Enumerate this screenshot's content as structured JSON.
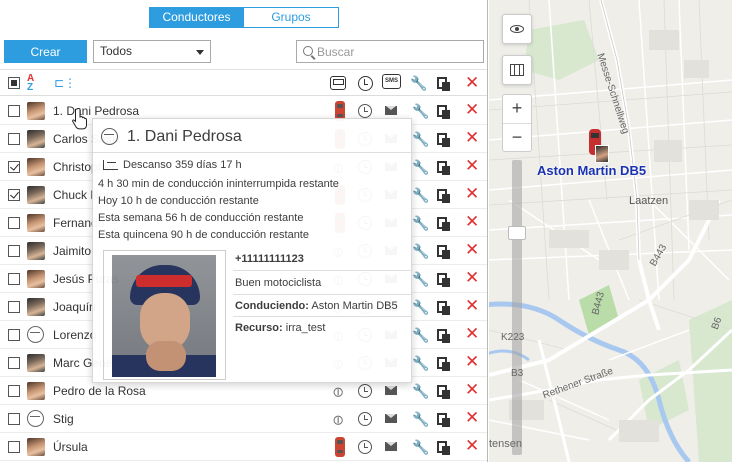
{
  "tabs": [
    {
      "label": "Conductores",
      "active": true
    },
    {
      "label": "Grupos",
      "active": false
    }
  ],
  "toolbar": {
    "create_label": "Crear",
    "filter_value": "Todos",
    "search_placeholder": "Buscar"
  },
  "header": {
    "az_top": "A",
    "az_bottom": "Z",
    "sms_label": "SMS"
  },
  "drivers": [
    {
      "name": "1. Dani Pedrosa",
      "checked": false,
      "avatar": "photo",
      "car": true
    },
    {
      "name": "Carlos Sainz",
      "checked": false,
      "avatar": "photo",
      "car": true
    },
    {
      "name": "Christopher",
      "checked": true,
      "avatar": "photo",
      "car": false
    },
    {
      "name": "Chuck Norris",
      "checked": true,
      "avatar": "photo",
      "car": true
    },
    {
      "name": "Fernando",
      "checked": false,
      "avatar": "photo",
      "car": true
    },
    {
      "name": "Jaimito",
      "checked": false,
      "avatar": "photo",
      "car": false
    },
    {
      "name": "Jesús Puras",
      "checked": false,
      "avatar": "photo",
      "car": false
    },
    {
      "name": "Joaquín",
      "checked": false,
      "avatar": "photo",
      "car": false
    },
    {
      "name": "Lorenzo",
      "checked": false,
      "avatar": "wheel",
      "car": false
    },
    {
      "name": "Marc Gené",
      "checked": false,
      "avatar": "photo",
      "car": false
    },
    {
      "name": "Pedro de la Rosa",
      "checked": false,
      "avatar": "photo",
      "car": false
    },
    {
      "name": "Stig",
      "checked": false,
      "avatar": "wheel",
      "car": false
    },
    {
      "name": "Úrsula",
      "checked": false,
      "avatar": "photo",
      "car": true
    }
  ],
  "popup": {
    "title": "1. Dani Pedrosa",
    "rest": "Descanso 359 días 17 h",
    "lines": [
      "4 h 30 min de conducción ininterrumpida restante",
      "Hoy 10 h de conducción restante",
      "Esta semana 56 h de conducción restante",
      "Esta quincena 90 h de conducción restante"
    ],
    "phone": "+11111111123",
    "description": "Buen motociclista",
    "driving_label": "Conduciendo:",
    "driving_value": "Aston Martin DB5",
    "resource_label": "Recurso:",
    "resource_value": "irra_test"
  },
  "map": {
    "unit_label": "Aston Martin DB5",
    "labels": {
      "laatzen": "Laatzen",
      "schnellweg": "Messe-Schnellweg",
      "b443": "B443",
      "b6": "B6",
      "b443b": "B443",
      "k223": "K223",
      "b3": "B3",
      "rethener": "Rethener Straße",
      "tensen": "tensen"
    },
    "zoom_in": "+",
    "zoom_out": "−"
  },
  "colors": {
    "accent": "#2d9de0",
    "delete": "#e03030",
    "unit_label": "#1a32b0"
  }
}
